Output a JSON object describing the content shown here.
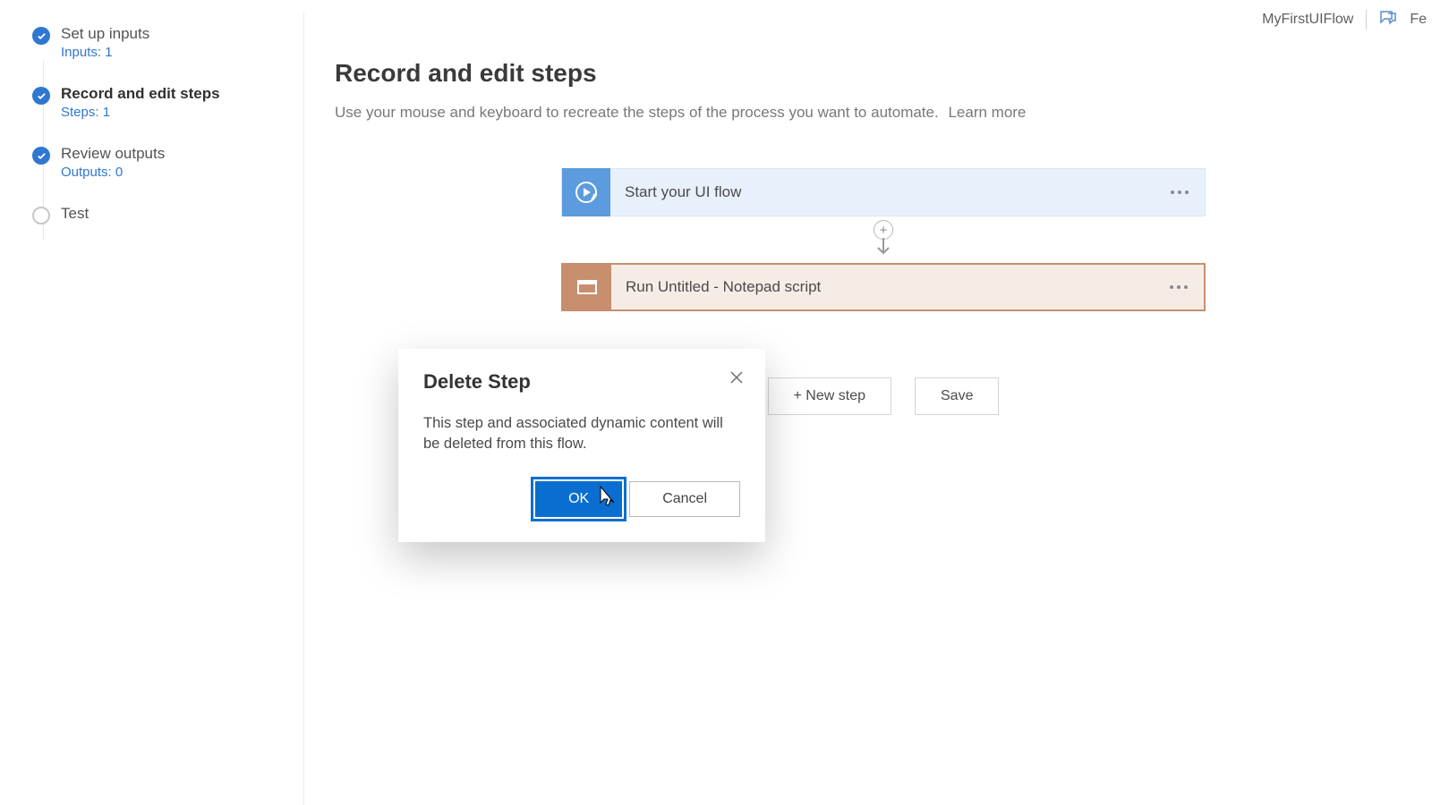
{
  "header": {
    "flow_name": "MyFirstUIFlow",
    "feedback_label": "Fe"
  },
  "sidebar": {
    "steps": [
      {
        "title": "Set up inputs",
        "sub": "Inputs: 1",
        "done": true,
        "active": false
      },
      {
        "title": "Record and edit steps",
        "sub": "Steps: 1",
        "done": true,
        "active": true
      },
      {
        "title": "Review outputs",
        "sub": "Outputs: 0",
        "done": true,
        "active": false
      },
      {
        "title": "Test",
        "sub": "",
        "done": false,
        "active": false
      }
    ]
  },
  "main": {
    "title": "Record and edit steps",
    "description": "Use your mouse and keyboard to recreate the steps of the process you want to automate.",
    "learn_more": "Learn more"
  },
  "cards": {
    "start": {
      "label": "Start your UI flow"
    },
    "run": {
      "label": "Run Untitled - Notepad script"
    }
  },
  "actions": {
    "new_step": "+ New step",
    "save": "Save"
  },
  "dialog": {
    "title": "Delete Step",
    "body": "This step and associated dynamic content will be deleted from this flow.",
    "ok": "OK",
    "cancel": "Cancel"
  }
}
